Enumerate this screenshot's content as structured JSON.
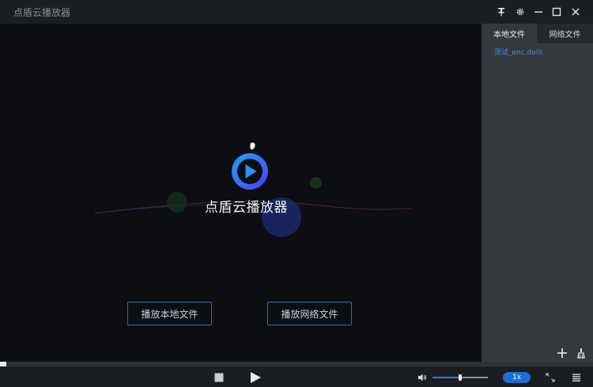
{
  "app": {
    "title": "点盾云播放器"
  },
  "window_controls": {
    "pin": "pin-icon",
    "settings": "gear-icon",
    "minimize": "minimize-icon",
    "maximize": "maximize-icon",
    "close": "close-icon"
  },
  "player": {
    "brand": "点盾云播放器",
    "buttons": {
      "local": "播放本地文件",
      "network": "播放网络文件"
    }
  },
  "sidebar": {
    "tabs": [
      {
        "label": "本地文件",
        "active": true
      },
      {
        "label": "网络文件",
        "active": false
      }
    ],
    "files": [
      "测试_enc.dolit"
    ]
  },
  "controls": {
    "progress": 0.01,
    "volume": 0.5,
    "speed": "1x"
  },
  "colors": {
    "accent": "#1e6fd2",
    "link": "#4a8cdf",
    "button_border": "#2f6eb7"
  }
}
